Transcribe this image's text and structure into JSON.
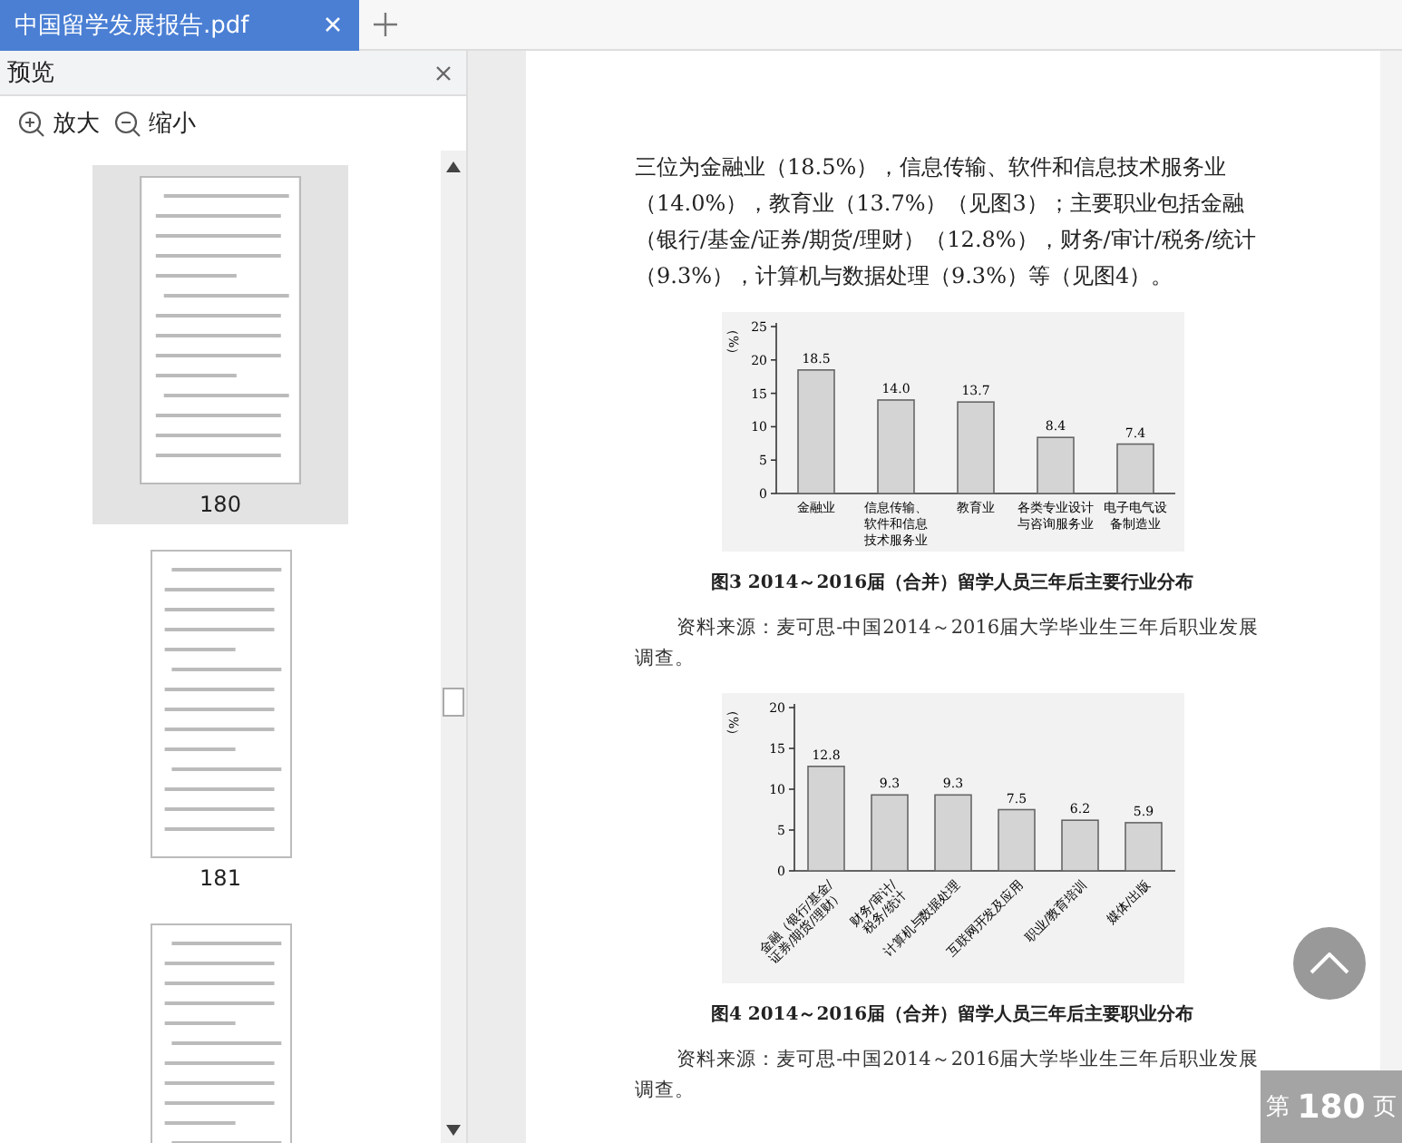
{
  "tabs": [
    {
      "label": "中国留学发展报告.pdf",
      "selected": true
    }
  ],
  "sidebar": {
    "title": "预览",
    "zoom_in": "放大",
    "zoom_out": "缩小",
    "thumbnails": [
      {
        "page": "180",
        "selected": true
      },
      {
        "page": "181",
        "selected": false
      },
      {
        "selected": false
      }
    ]
  },
  "document": {
    "paragraph": "三位为金融业（18.5%），信息传输、软件和信息技术服务业（14.0%），教育业（13.7%）（见图3）；主要职业包括金融（银行/基金/证券/期货/理财）（12.8%），财务/审计/税务/统计（9.3%），计算机与数据处理（9.3%）等（见图4）。",
    "figures": [
      {
        "caption": "图3 2014～2016届（合并）留学人员三年后主要行业分布",
        "source": "资料来源：麦可思-中国2014～2016届大学毕业生三年后职业发展调查。",
        "chart_data": {
          "type": "bar",
          "ylabel": "（%）",
          "categories": [
            "金融业",
            "信息传输、软件和信息技术服务业",
            "教育业",
            "各类专业设计与咨询服务业",
            "电子电气设备制造业"
          ],
          "values": [
            18.5,
            14.0,
            13.7,
            8.4,
            7.4
          ],
          "value_labels": [
            "18.5",
            "14.0",
            "13.7",
            "8.4",
            "7.4"
          ],
          "ylim": [
            0,
            25
          ],
          "yticks": [
            0,
            5,
            10,
            15,
            20,
            25
          ]
        }
      },
      {
        "caption": "图4 2014～2016届（合并）留学人员三年后主要职业分布",
        "source": "资料来源：麦可思-中国2014～2016届大学毕业生三年后职业发展调查。",
        "chart_data": {
          "type": "bar",
          "ylabel": "（%）",
          "categories": [
            "金融（银行/基金/证券/期货/理财）",
            "财务/审计/税务/统计",
            "计算机与数据处理",
            "互联网开发及应用",
            "职业/教育培训",
            "媒体/出版"
          ],
          "values": [
            12.8,
            9.3,
            9.3,
            7.5,
            6.2,
            5.9
          ],
          "value_labels": [
            "12.8",
            "9.3",
            "9.3",
            "7.5",
            "6.2",
            "5.9"
          ],
          "ylim": [
            0,
            20
          ],
          "yticks": [
            0,
            5,
            10,
            15,
            20
          ]
        }
      }
    ]
  },
  "page_indicator": {
    "prefix": "第",
    "number": "180",
    "suffix": "页"
  }
}
